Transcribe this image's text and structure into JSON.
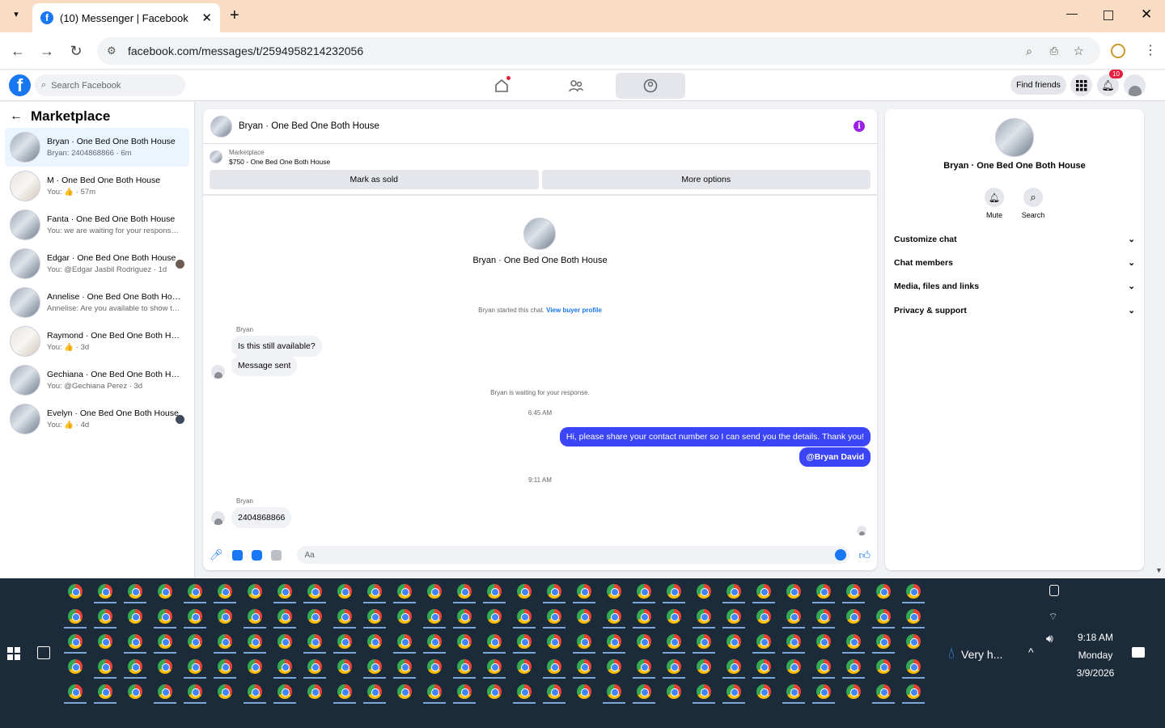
{
  "browser": {
    "tab_title": "(10) Messenger | Facebook",
    "url": "facebook.com/messages/t/2594958214232056"
  },
  "fb_header": {
    "search_placeholder": "Search Facebook",
    "find_friends": "Find friends",
    "notification_count": "10"
  },
  "left_panel": {
    "title": "Marketplace",
    "conversations": [
      {
        "name": "Bryan · One Bed One Both House",
        "preview": "Bryan: 2404868866 · 6m",
        "avatar": "house"
      },
      {
        "name": "M · One Bed One Both House",
        "preview": "You: 👍 · 57m",
        "avatar": "light"
      },
      {
        "name": "Fanta · One Bed One Both House",
        "preview": "You: we are waiting for your response. · 2h",
        "avatar": "house"
      },
      {
        "name": "Edgar · One Bed One Both House",
        "preview": "You: @Edgar Jasbil Rodriguez · 1d",
        "avatar": "house"
      },
      {
        "name": "Annelise · One Bed One Both House",
        "preview": "Annelise: Are you available to show th... · 3d",
        "avatar": "house"
      },
      {
        "name": "Raymond · One Bed One Both Ho...",
        "preview": "You: 👍 · 3d",
        "avatar": "light"
      },
      {
        "name": "Gechiana · One Bed One Both Hou...",
        "preview": "You: @Gechiana Perez · 3d",
        "avatar": "house"
      },
      {
        "name": "Evelyn · One Bed One Both House",
        "preview": "You: 👍 · 4d",
        "avatar": "house"
      }
    ]
  },
  "chat": {
    "header_name": "Bryan · One Bed One Both House",
    "marketplace_label": "Marketplace",
    "listing": "$750 - One Bed One Both House",
    "mark_sold": "Mark as sold",
    "more_options": "More options",
    "profile_name": "Bryan · One Bed One Both House",
    "started_text": "Bryan started this chat.",
    "view_buyer": "View buyer profile",
    "sender1": "Bryan",
    "msg1": "Is this still available?",
    "msg2": "Message sent",
    "waiting": "Bryan is waiting for your response.",
    "time1": "6:45 AM",
    "out1": "Hi, please share your contact number so I can send you the details. Thank you!",
    "out2": "@Bryan David",
    "time2": "9:11 AM",
    "sender2": "Bryan",
    "msg3": "2404868866",
    "composer_placeholder": "Aa"
  },
  "right_panel": {
    "name": "Bryan · One Bed One Both House",
    "mute": "Mute",
    "search": "Search",
    "sections": [
      "Customize chat",
      "Chat members",
      "Media, files and links",
      "Privacy & support"
    ]
  },
  "taskbar": {
    "weather": "Very h...",
    "time": "9:18 AM",
    "day": "Monday",
    "date": "3/9/2026"
  },
  "colors": {
    "fb_blue": "#1877f2",
    "outgoing_bubble": "#3b45f5",
    "tab_bar": "#f9dcc4",
    "taskbar": "#1c2b3a",
    "notification_badge": "#e41e3f"
  }
}
